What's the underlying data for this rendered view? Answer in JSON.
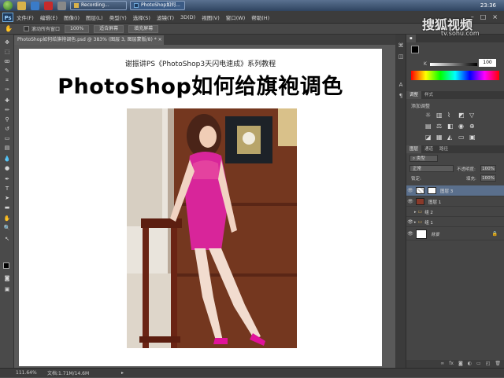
{
  "taskbar": {
    "tasks": [
      {
        "label": "",
        "type": "icon"
      },
      {
        "label": "Recording...",
        "type": "task"
      },
      {
        "label": "PhotoShop如何...",
        "type": "task-active"
      }
    ],
    "clock": "23:36"
  },
  "menubar": {
    "logo": "Ps",
    "items": [
      "文件(F)",
      "编辑(E)",
      "图像(I)",
      "图层(L)",
      "类型(Y)",
      "选择(S)",
      "滤镜(T)",
      "3D(D)",
      "视图(V)",
      "窗口(W)",
      "帮助(H)"
    ]
  },
  "options": {
    "checkbox_label": "滚动所有窗口",
    "buttons": [
      "100%",
      "适合屏幕",
      "填充屏幕"
    ]
  },
  "document_tab": {
    "title": "PhotoShop如何给旗袍调色.psd @ 383% (图层 3, 图层蒙版/8) * ×"
  },
  "document": {
    "subtitle": "谢振讲PS《PhotoShop3天闪电速成》系列教程",
    "headline": "PhotoShop如何给旗袍调色"
  },
  "status": {
    "zoom": "111.64%",
    "doc_info": "文档:1.71M/14.6M"
  },
  "watermark": {
    "brand": "搜狐视频",
    "url": "tv.sohu.com"
  },
  "color_panel": {
    "channel_label": "K",
    "value": "100"
  },
  "adjustments_panel": {
    "tabs": [
      "调整",
      "样式"
    ],
    "title": "添加调整"
  },
  "layers_panel": {
    "tabs": [
      "图层",
      "通道",
      "路径"
    ],
    "filter_label": "类型",
    "blend_mode": "正常",
    "opacity_label": "不透明度:",
    "opacity": "100%",
    "lock_label": "锁定:",
    "fill_label": "填充:",
    "fill": "100%",
    "layers": [
      {
        "name": "图层 3",
        "active": true
      },
      {
        "name": "图层 1",
        "active": false
      },
      {
        "name": "组 2",
        "active": false
      },
      {
        "name": "组 1",
        "active": false
      },
      {
        "name": "背景",
        "active": false
      }
    ]
  },
  "colors": {
    "accent": "#5a6f8c",
    "dress": "#d8259a",
    "panel_bg": "#454545"
  }
}
